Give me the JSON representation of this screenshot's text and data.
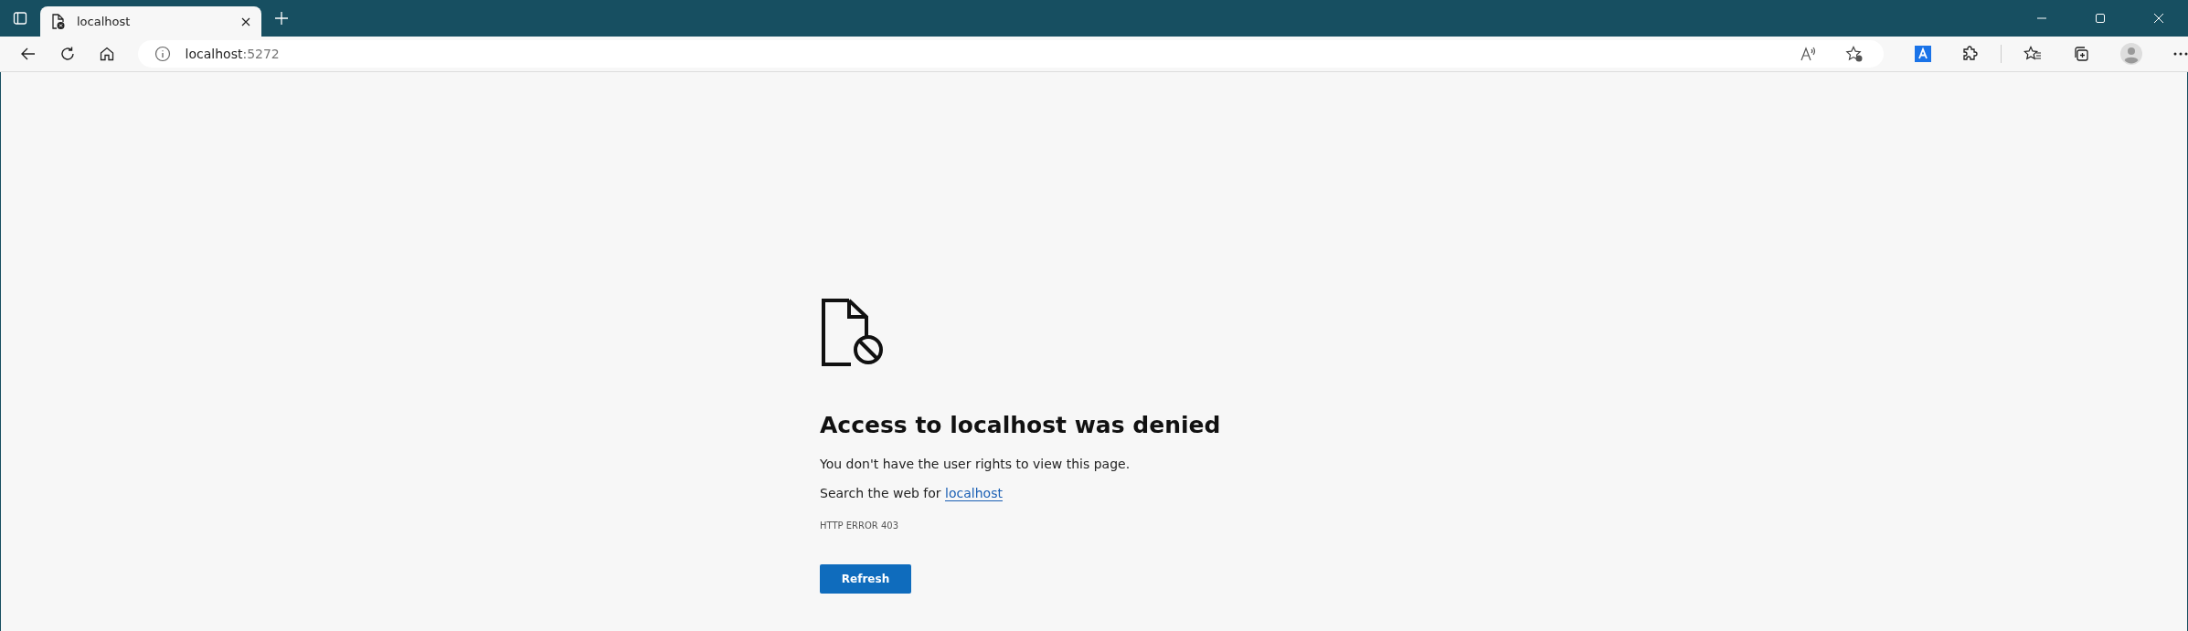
{
  "tabs": [
    {
      "title": "localhost",
      "selected": true
    }
  ],
  "address_bar": {
    "host": "localhost",
    "port": ":5272"
  },
  "error_page": {
    "heading": "Access to localhost was denied",
    "message": "You don't have the user rights to view this page.",
    "search_prefix": "Search the web for",
    "search_link": "localhost",
    "error_code": "HTTP ERROR 403",
    "button": "Refresh"
  }
}
